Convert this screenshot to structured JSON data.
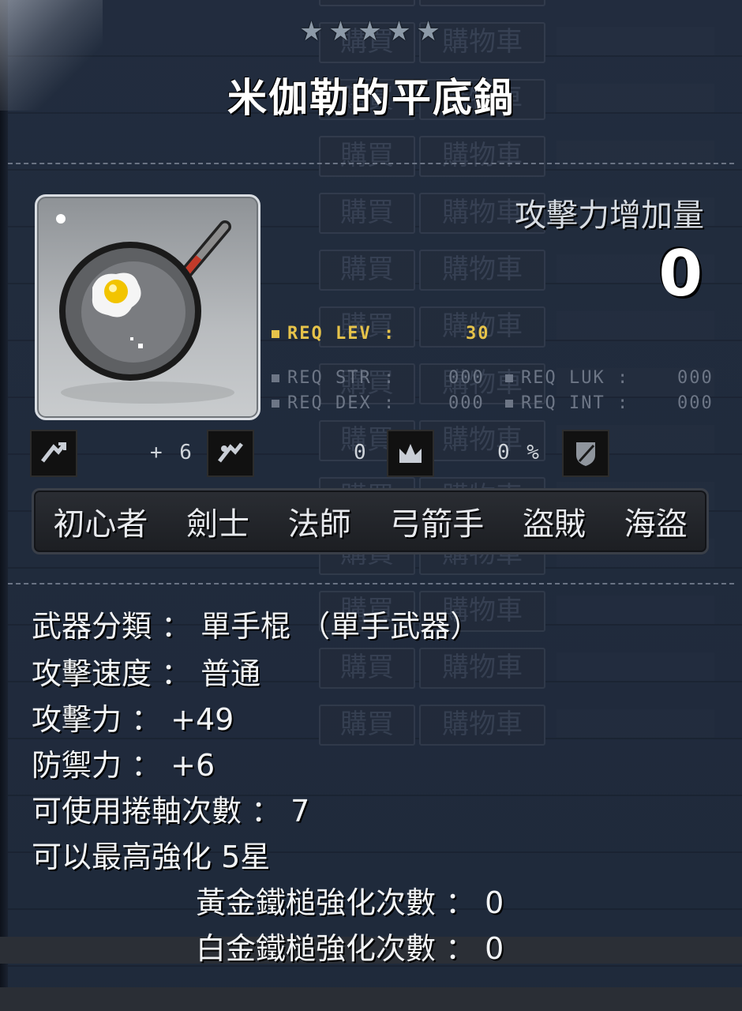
{
  "shop": {
    "buy_label": "購買",
    "cart_label": "購物車",
    "rows": 14
  },
  "tooltip": {
    "stars_count": 5,
    "item_name": "米伽勒的平底鍋",
    "attack_increase_label": "攻擊力增加量",
    "attack_increase_value": "0",
    "req_lev": {
      "label": "REQ LEV :",
      "value": "30"
    },
    "req_str": {
      "label": "REQ STR :",
      "value": "000"
    },
    "req_luk": {
      "label": "REQ LUK :",
      "value": "000"
    },
    "req_dex": {
      "label": "REQ DEX :",
      "value": "000"
    },
    "req_int": {
      "label": "REQ INT :",
      "value": "000"
    },
    "upgrade_value": "+ 6",
    "zero_value": "0",
    "percent_value": "0 %",
    "jobs": [
      "初心者",
      "劍士",
      "法師",
      "弓箭手",
      "盜賊",
      "海盜"
    ],
    "stats": {
      "weapon_type": "武器分類 ： 單手棍 （單手武器）",
      "attack_speed": "攻擊速度 ： 普通",
      "attack": "攻擊力 ： +49",
      "defense": "防禦力 ： +6",
      "scroll_slots": "可使用捲軸次數 ： 7",
      "max_stars": "可以最高強化 5星",
      "gold_hammer": "黃金鐵槌強化次數 ： 0",
      "platinum_hammer": "白金鐵槌強化次數 ： 0"
    }
  },
  "colors": {
    "req_lev": "#e6c34a",
    "req_other": "#6d7686",
    "text": "#f2f4f6",
    "panel": "#1e2a3c"
  }
}
